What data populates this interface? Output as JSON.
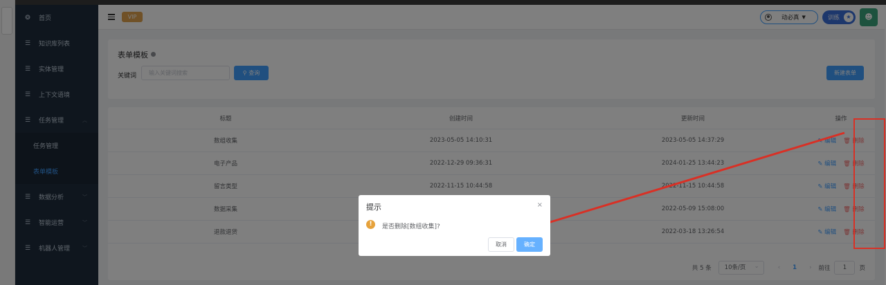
{
  "sidebar": {
    "items": [
      {
        "label": "首页",
        "icon": "dashboard-icon",
        "glyph": "❂"
      },
      {
        "label": "知识库列表",
        "icon": "list-icon",
        "glyph": "☰"
      },
      {
        "label": "实体管理",
        "icon": "list-icon",
        "glyph": "☰"
      },
      {
        "label": "上下文语境",
        "icon": "list-icon",
        "glyph": "☰"
      },
      {
        "label": "任务管理",
        "icon": "list-icon",
        "glyph": "☰",
        "chevron": "︿"
      },
      {
        "label": "数据分析",
        "icon": "list-icon",
        "glyph": "☰",
        "chevron": "﹀"
      },
      {
        "label": "智能运营",
        "icon": "list-icon",
        "glyph": "☰",
        "chevron": "﹀"
      },
      {
        "label": "机器人管理",
        "icon": "list-icon",
        "glyph": "☰",
        "chevron": "﹀"
      }
    ],
    "submenu": [
      {
        "label": "任务管理"
      },
      {
        "label": "表单模板"
      }
    ]
  },
  "navbar": {
    "vip_label": "VIP",
    "env_label": "动必真",
    "train_label": "训练",
    "star_glyph": "★",
    "avatar_glyph": "☻"
  },
  "search": {
    "title": "表单模板",
    "keyword_label": "关键词",
    "keyword_placeholder": "输入关键词搜索",
    "query_button": "查询",
    "new_button": "新建表单"
  },
  "table": {
    "headers": [
      "标题",
      "创建时间",
      "更新时间",
      "操作"
    ],
    "rows": [
      {
        "title": "数组收集",
        "created": "2023-05-05 14:10:31",
        "updated": "2023-05-05 14:37:29"
      },
      {
        "title": "电子产品",
        "created": "2022-12-29 09:36:31",
        "updated": "2024-01-25 13:44:23"
      },
      {
        "title": "留言类型",
        "created": "2022-11-15 10:44:58",
        "updated": "2022-11-15 10:44:58"
      },
      {
        "title": "数据采集",
        "created": "",
        "updated": "2022-05-09 15:08:00"
      },
      {
        "title": "退款退货",
        "created": "",
        "updated": "2022-03-18 13:26:54"
      }
    ],
    "edit_label": "编辑",
    "delete_label": "删除"
  },
  "pagination": {
    "total": "共 5 条",
    "page_size": "10条/页",
    "prev": "‹",
    "current": "1",
    "next": "›",
    "goto_label": "前往",
    "goto_value": "1",
    "page_unit": "页"
  },
  "dialog": {
    "title": "提示",
    "close_glyph": "×",
    "warn_glyph": "!",
    "message": "是否删除[数组收集]?",
    "cancel": "取消",
    "confirm": "确定"
  },
  "colors": {
    "sidebar_bg": "#1f2d3d",
    "primary": "#409eff",
    "danger": "#f56c6c",
    "annotation_red": "#d93025"
  }
}
